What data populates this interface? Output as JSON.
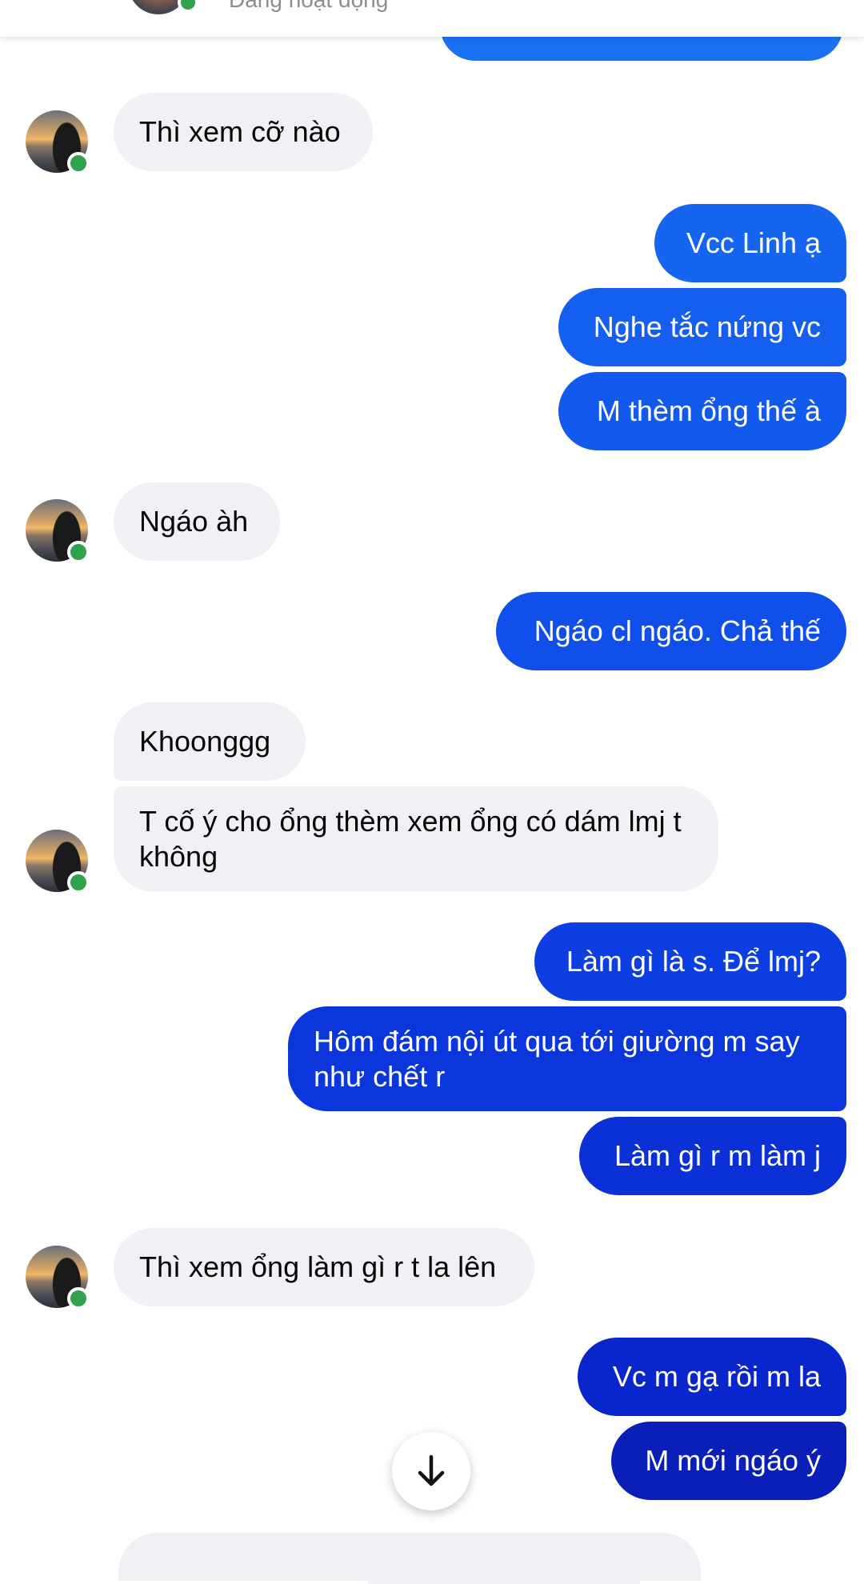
{
  "header": {
    "status_text": "Đang hoạt động"
  },
  "colors": {
    "incoming_bubble": "#f0f1f4",
    "outgoing_gradient_top": "#1877f2",
    "outgoing_gradient_bottom": "#0a1fb8",
    "online": "#31a24c"
  },
  "messages": [
    {
      "sender": "me",
      "text": ""
    },
    {
      "sender": "them",
      "text": "Thì xem cỡ nào"
    },
    {
      "sender": "me",
      "text": "Vcc Linh ạ"
    },
    {
      "sender": "me",
      "text": "Nghe tắc nứng vc"
    },
    {
      "sender": "me",
      "text": "M thèm ổng thế à"
    },
    {
      "sender": "them",
      "text": "Ngáo àh"
    },
    {
      "sender": "me",
      "text": "Ngáo cl ngáo. Chả thế"
    },
    {
      "sender": "them",
      "text": "Khoonggg"
    },
    {
      "sender": "them",
      "text": "T cố ý cho ổng thèm xem ổng có dám lmj t không"
    },
    {
      "sender": "me",
      "text": "Làm gì là s. Để lmj?"
    },
    {
      "sender": "me",
      "text": "Hôm đám nội út qua tới giường m say như chết r"
    },
    {
      "sender": "me",
      "text": "Làm gì r m làm j"
    },
    {
      "sender": "them",
      "text": "Thì xem ổng làm gì r t la lên"
    },
    {
      "sender": "me",
      "text": "Vc m gạ rồi m la"
    },
    {
      "sender": "me",
      "text": "M mới ngáo ý"
    }
  ],
  "controls": {
    "scroll_down_icon": "arrow-down-icon"
  }
}
